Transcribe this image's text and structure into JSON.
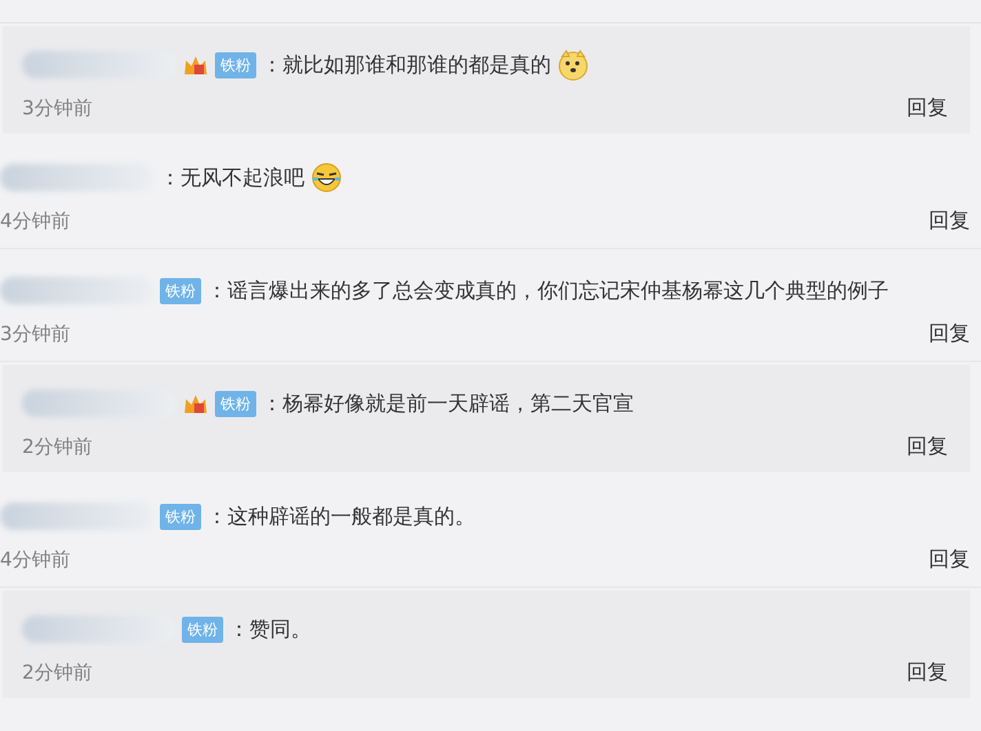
{
  "comments": [
    {
      "indented": true,
      "crown": true,
      "badge": "铁粉",
      "text": "：就比如那谁和那谁的都是真的",
      "emoji": {
        "kind": "dog"
      },
      "time": "3分钟前",
      "reply": "回复"
    },
    {
      "indented": false,
      "crown": false,
      "text": "：无风不起浪吧",
      "emoji": {
        "kind": "laugh"
      },
      "time": "4分钟前",
      "reply": "回复"
    },
    {
      "indented": false,
      "crown": false,
      "badge": "铁粉",
      "text": "：谣言爆出来的多了总会变成真的，你们忘记宋仲基杨幂这几个典型的例子",
      "time": "3分钟前",
      "reply": "回复"
    },
    {
      "indented": true,
      "crown": true,
      "badge": "铁粉",
      "text": "：杨幂好像就是前一天辟谣，第二天官宣",
      "time": "2分钟前",
      "reply": "回复"
    },
    {
      "indented": false,
      "crown": false,
      "badge": "铁粉",
      "text": "：这种辟谣的一般都是真的。",
      "time": "4分钟前",
      "reply": "回复"
    },
    {
      "indented": true,
      "crown": false,
      "badge": "铁粉",
      "text": "：赞同。",
      "time": "2分钟前",
      "reply": "回复"
    }
  ]
}
